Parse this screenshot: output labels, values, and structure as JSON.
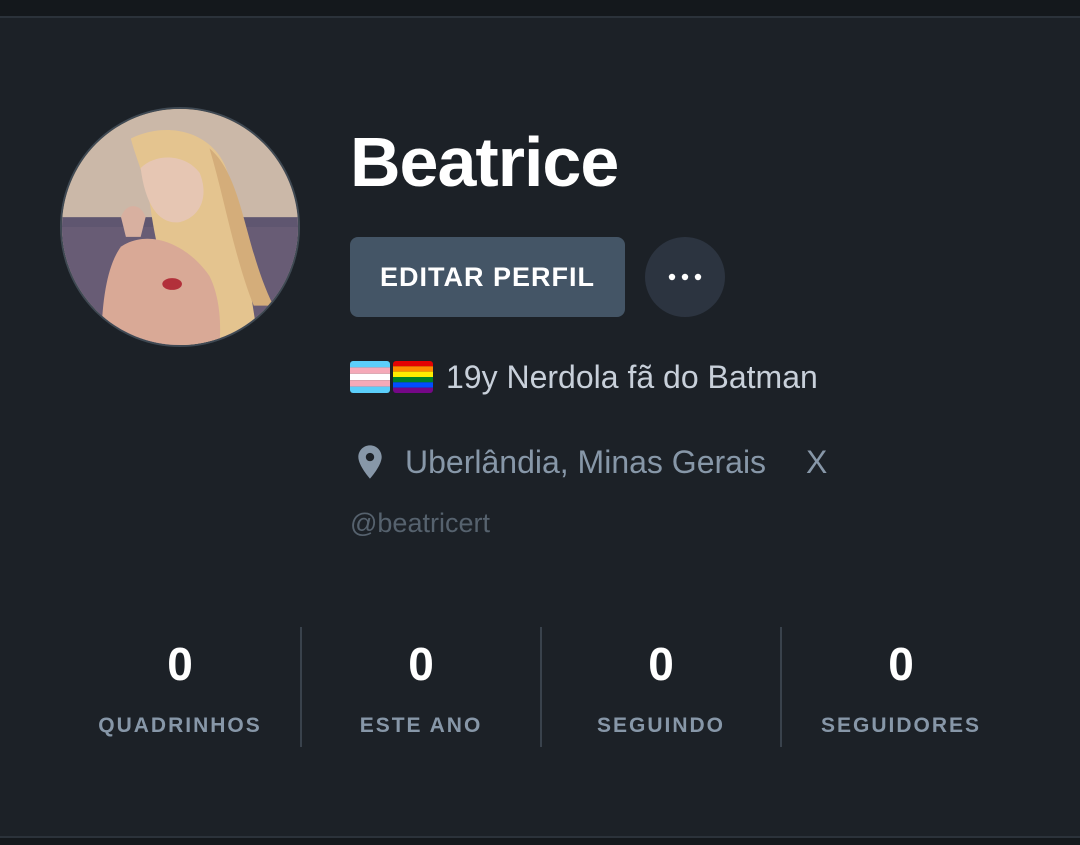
{
  "profile": {
    "name": "Beatrice",
    "edit_label": "EDITAR PERFIL",
    "more_icon": "more-horizontal-icon",
    "bio_flags": [
      "transgender-flag",
      "rainbow-flag"
    ],
    "bio": "19y Nerdola fã do Batman",
    "location_icon": "map-pin-icon",
    "location": "Uberlândia, Minas Gerais",
    "location_x": "X",
    "handle": "@beatricert"
  },
  "stats": [
    {
      "value": "0",
      "label": "QUADRINHOS"
    },
    {
      "value": "0",
      "label": "ESTE ANO"
    },
    {
      "value": "0",
      "label": "SEGUINDO"
    },
    {
      "value": "0",
      "label": "SEGUIDORES"
    }
  ],
  "colors": {
    "background": "#1c2127",
    "button": "#445566",
    "muted_text": "#8797a8"
  }
}
